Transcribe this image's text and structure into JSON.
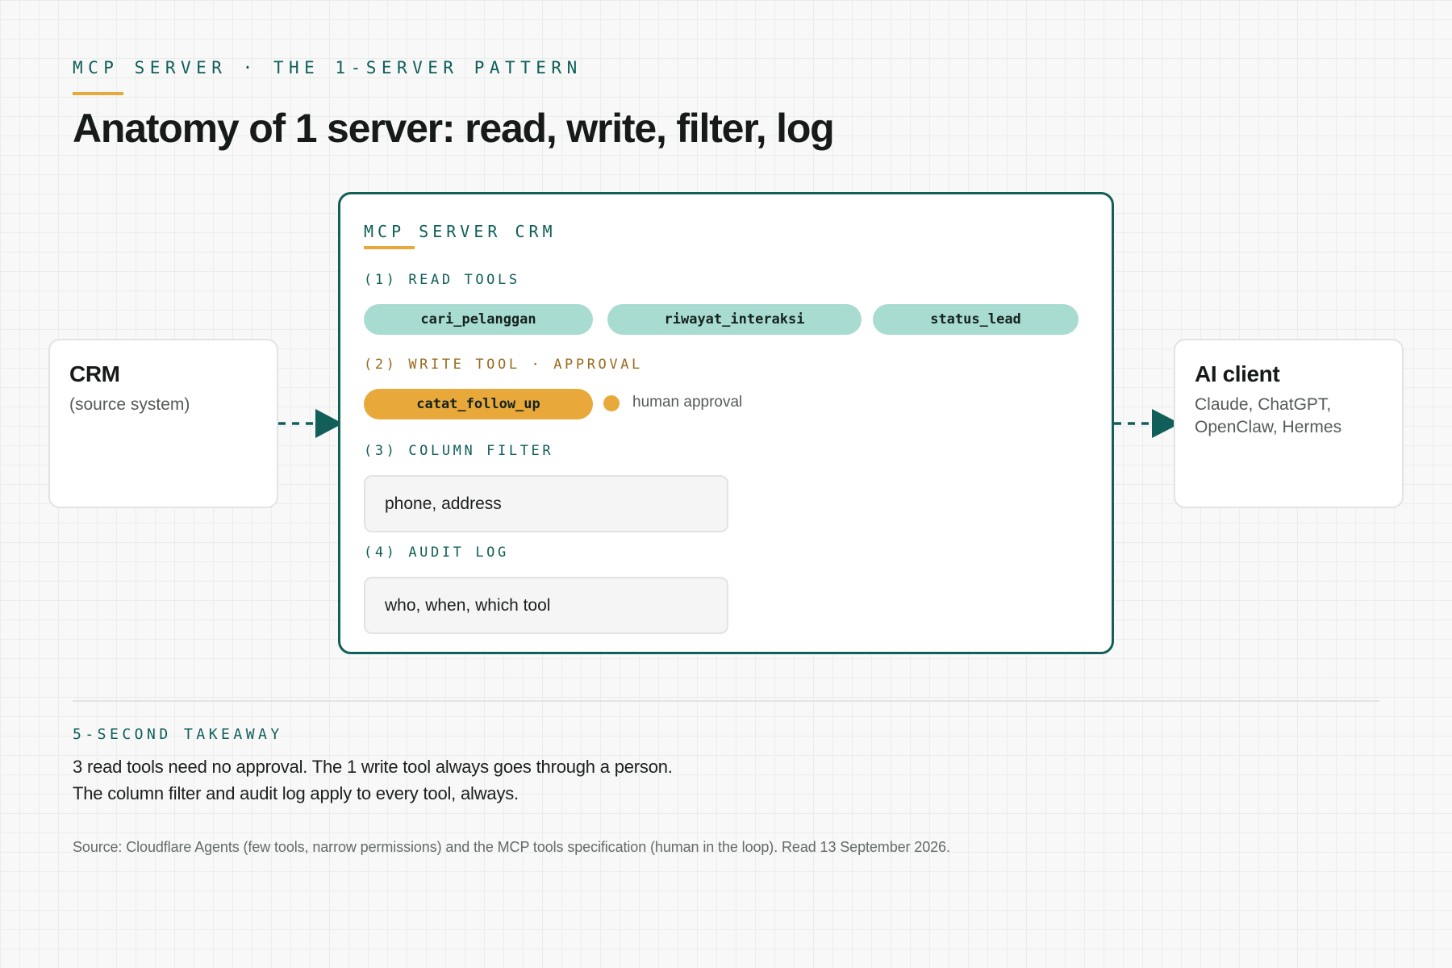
{
  "header": {
    "kicker": "MCP SERVER · THE 1-SERVER PATTERN",
    "title": "Anatomy of 1 server: read, write, filter, log"
  },
  "source_box": {
    "title": "CRM",
    "subtitle": "(source system)"
  },
  "client_box": {
    "title": "AI client",
    "subtitle_lines": [
      "Claude, ChatGPT,",
      "OpenClaw, Hermes"
    ]
  },
  "server": {
    "title": "MCP SERVER CRM",
    "read": {
      "label": "(1) READ TOOLS",
      "tools": [
        "cari_pelanggan",
        "riwayat_interaksi",
        "status_lead"
      ]
    },
    "write": {
      "label": "(2) WRITE TOOL · APPROVAL",
      "tool": "catat_follow_up",
      "approval_note": "human approval"
    },
    "filter": {
      "label": "(3) COLUMN FILTER",
      "value": "phone, address"
    },
    "audit": {
      "label": "(4) AUDIT LOG",
      "value": "who, when, which tool"
    }
  },
  "takeaway": {
    "label": "5-SECOND TAKEAWAY",
    "lines": [
      "3 read tools need no approval. The 1 write tool always goes through a person.",
      "The column filter and audit log apply to every tool, always."
    ]
  },
  "source_note": "Source: Cloudflare Agents (few tools, narrow permissions) and the MCP tools specification (human in the loop). Read 13 September 2026.",
  "colors": {
    "teal": "#125e58",
    "amber": "#e8a93a",
    "mint": "#a9dcd0"
  }
}
